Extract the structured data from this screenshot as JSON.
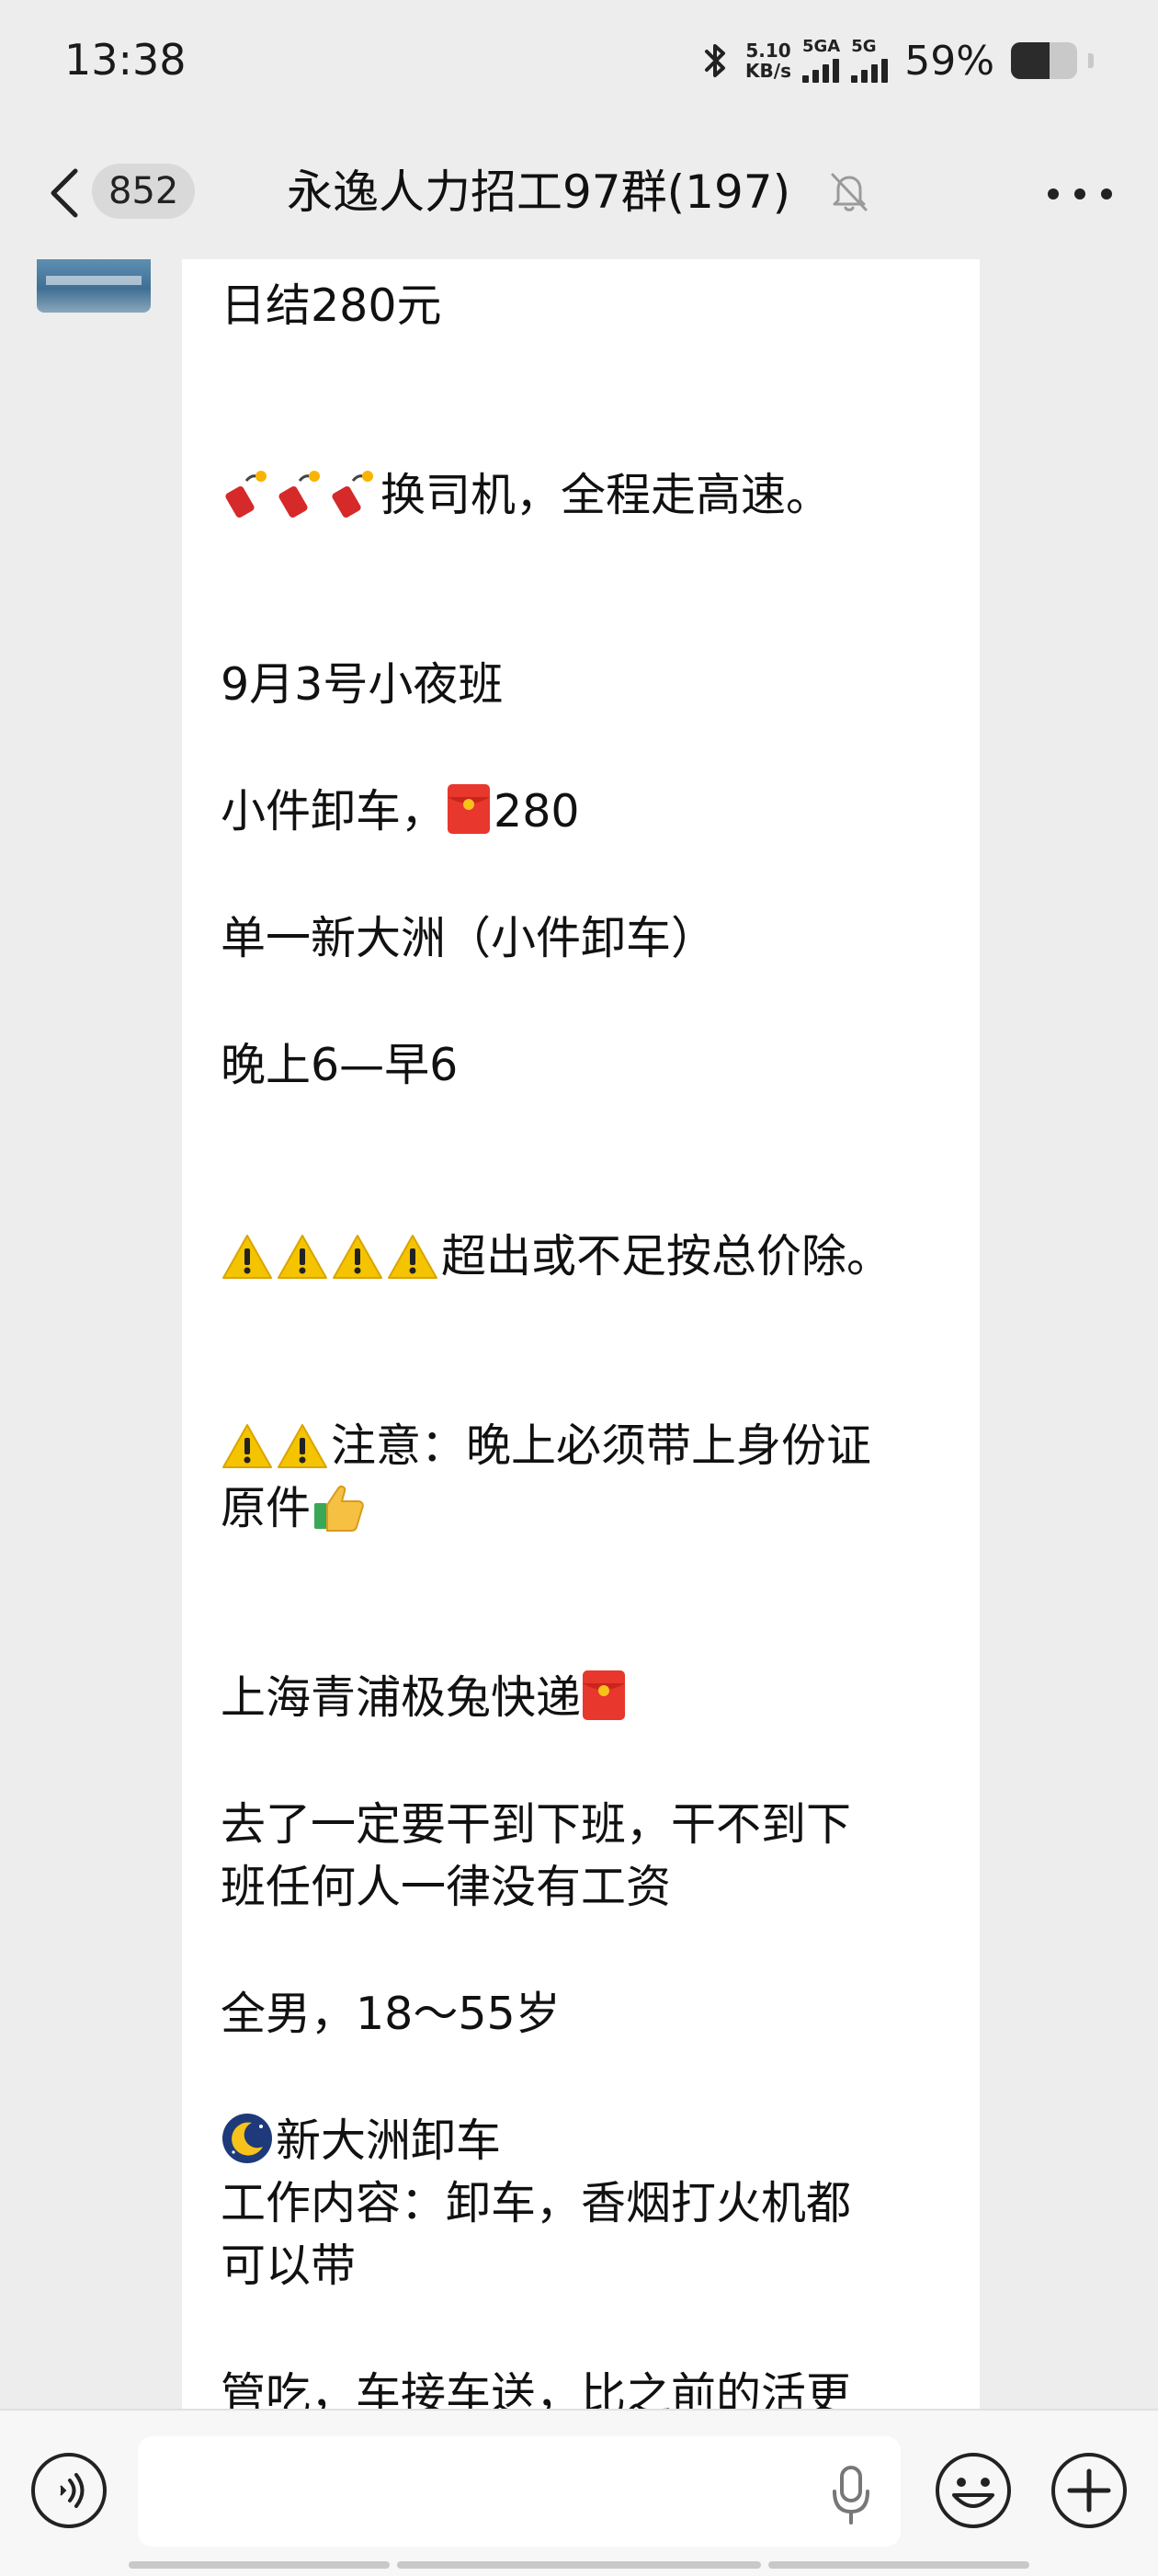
{
  "status_bar": {
    "time": "13:38",
    "net_speed_value": "5.10",
    "net_speed_unit": "KB/s",
    "sim1_label": "5GA",
    "sim2_label": "5G",
    "battery_percent": 59,
    "battery_text": "59%",
    "icons": [
      "bluetooth-icon",
      "signal-icon",
      "battery-icon"
    ]
  },
  "header": {
    "back_icon": "chevron-left-icon",
    "unread_count": "852",
    "title": "永逸人力招工97群(197)",
    "mute_icon": "bell-muted-icon",
    "more_icon": "more-dots-icon"
  },
  "message": {
    "lines": [
      "日结280元",
      "换司机，全程走高速。",
      "9月3号小夜班",
      "小件卸车，",
      "280",
      "单一新大洲（小件卸车）",
      "晚上6—早6",
      "超出或不足按总价除。",
      "注意：晚上必须带上身份证",
      "原件",
      "上海青浦极兔快递",
      "去了一定要干到下班，干不到下",
      "班任何人一律没有工资",
      "全男，18～55岁",
      "新大洲卸车",
      "工作内容：卸车，香烟打火机都",
      "可以带",
      "管吃，车接车送，比之前的活更"
    ]
  },
  "input_bar": {
    "voice_icon": "voice-mode-icon",
    "input_value": "",
    "mic_icon": "microphone-icon",
    "emoji_icon": "emoji-face-icon",
    "plus_icon": "plus-circle-icon"
  },
  "colors": {
    "background": "#ededed",
    "bubble": "#ffffff",
    "red_envelope": "#e8372c",
    "warning": "#f5c400"
  }
}
